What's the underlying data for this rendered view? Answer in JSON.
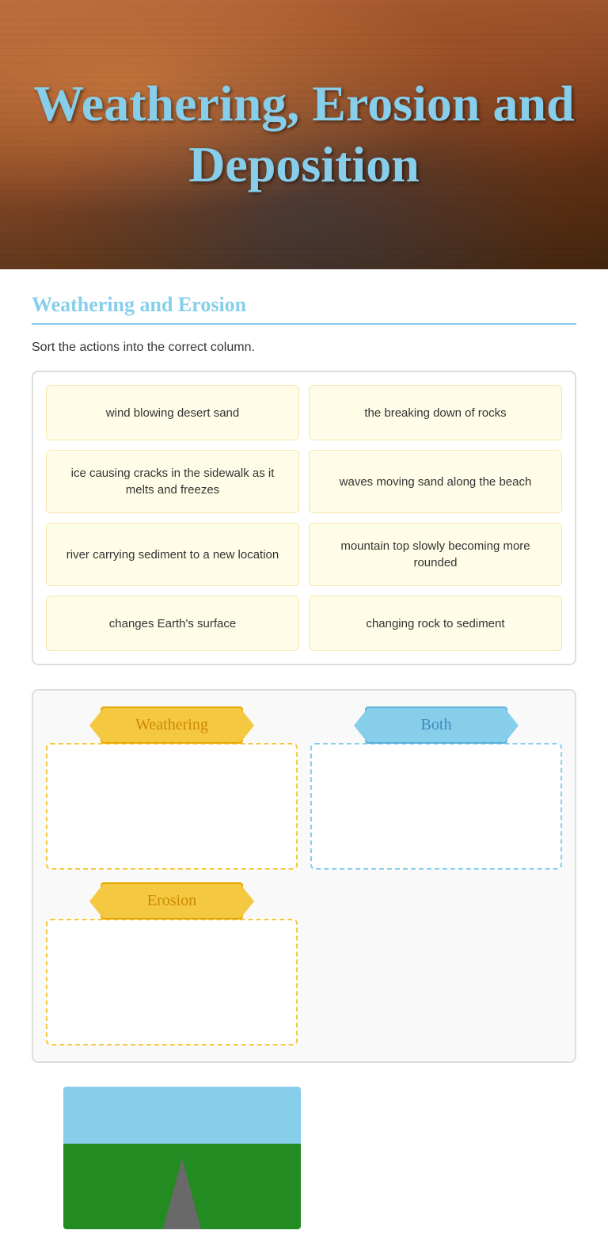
{
  "hero": {
    "title": "Weathering, Erosion and Deposition"
  },
  "section": {
    "title": "Weathering and Erosion",
    "subtitle": "Sort the actions into the correct column.",
    "sort_cards": [
      {
        "id": "card1",
        "text": "wind blowing desert sand"
      },
      {
        "id": "card2",
        "text": "the breaking down of rocks"
      },
      {
        "id": "card3",
        "text": "ice causing cracks in the sidewalk as it melts and freezes"
      },
      {
        "id": "card4",
        "text": "waves moving sand along the beach"
      },
      {
        "id": "card5",
        "text": "river carrying sediment to a new location"
      },
      {
        "id": "card6",
        "text": "mountain top slowly becoming more rounded"
      },
      {
        "id": "card7",
        "text": "changes Earth's surface"
      },
      {
        "id": "card8",
        "text": "changing rock to sediment"
      }
    ],
    "dropzones": {
      "weathering": {
        "label": "Weathering",
        "items": []
      },
      "both": {
        "label": "Both",
        "items": []
      },
      "erosion": {
        "label": "Erosion",
        "items": []
      }
    }
  }
}
